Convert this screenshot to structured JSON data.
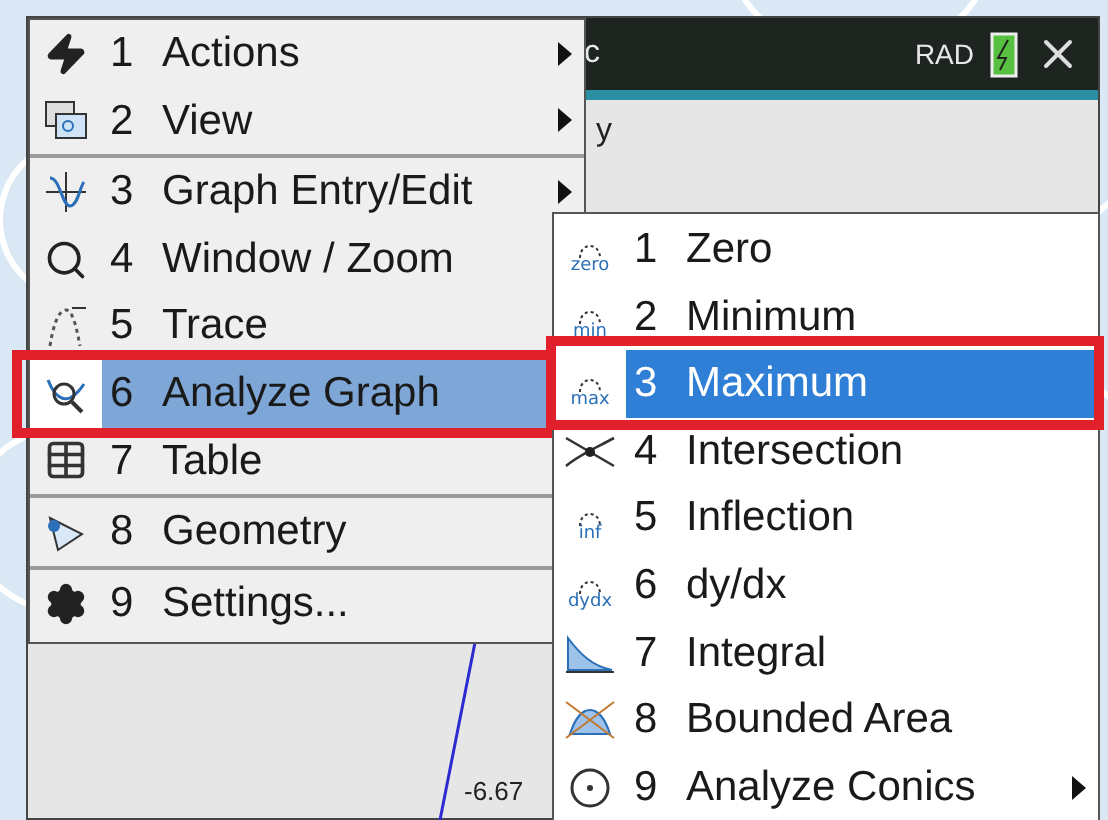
{
  "screen": {
    "title_fragment": "c",
    "angle_mode": "RAD",
    "axis_label": "y",
    "tick_label": "-6.67"
  },
  "menu": {
    "items": [
      {
        "number": "1",
        "label": "Actions",
        "kind": "bolt",
        "submenu": true,
        "divider_before": false,
        "selected": false,
        "framed": false
      },
      {
        "number": "2",
        "label": "View",
        "kind": "view",
        "submenu": true,
        "divider_before": false,
        "selected": false,
        "framed": false
      },
      {
        "number": "3",
        "label": "Graph Entry/Edit",
        "kind": "graph-entry",
        "submenu": true,
        "divider_before": true,
        "selected": false,
        "framed": false
      },
      {
        "number": "4",
        "label": "Window / Zoom",
        "kind": "zoom",
        "divider_before": false,
        "selected": false,
        "framed": false
      },
      {
        "number": "5",
        "label": "Trace",
        "kind": "trace",
        "divider_before": false,
        "selected": false,
        "framed": false
      },
      {
        "number": "6",
        "label": "Analyze Graph",
        "kind": "analyze",
        "divider_before": false,
        "selected": true,
        "framed": true
      },
      {
        "number": "7",
        "label": "Table",
        "kind": "table",
        "divider_before": false,
        "selected": false,
        "framed": false
      },
      {
        "number": "8",
        "label": "Geometry",
        "kind": "geometry",
        "divider_before": true,
        "selected": false,
        "framed": false
      },
      {
        "number": "9",
        "label": "Settings...",
        "kind": "gear",
        "divider_before": true,
        "selected": false,
        "framed": false
      }
    ]
  },
  "submenu": {
    "items": [
      {
        "number": "1",
        "label": "Zero",
        "kind": "point",
        "icon_text": "zero",
        "submenu": false,
        "selected": false,
        "framed": false
      },
      {
        "number": "2",
        "label": "Minimum",
        "kind": "point",
        "icon_text": "min",
        "submenu": false,
        "selected": false,
        "framed": false
      },
      {
        "number": "3",
        "label": "Maximum",
        "kind": "point",
        "icon_text": "max",
        "submenu": false,
        "selected": true,
        "framed": true
      },
      {
        "number": "4",
        "label": "Intersection",
        "kind": "intersection",
        "submenu": false,
        "selected": false,
        "framed": false
      },
      {
        "number": "5",
        "label": "Inflection",
        "kind": "point",
        "icon_text": "inf",
        "submenu": false,
        "selected": false,
        "framed": false
      },
      {
        "number": "6",
        "label": "dy/dx",
        "kind": "point",
        "icon_text": "dydx",
        "submenu": false,
        "selected": false,
        "framed": false
      },
      {
        "number": "7",
        "label": "Integral",
        "kind": "integral",
        "submenu": false,
        "selected": false,
        "framed": false
      },
      {
        "number": "8",
        "label": "Bounded Area",
        "kind": "bounded-area",
        "submenu": false,
        "selected": false,
        "framed": false
      },
      {
        "number": "9",
        "label": "Analyze Conics",
        "kind": "conics",
        "submenu": true,
        "selected": false,
        "framed": false
      }
    ]
  }
}
